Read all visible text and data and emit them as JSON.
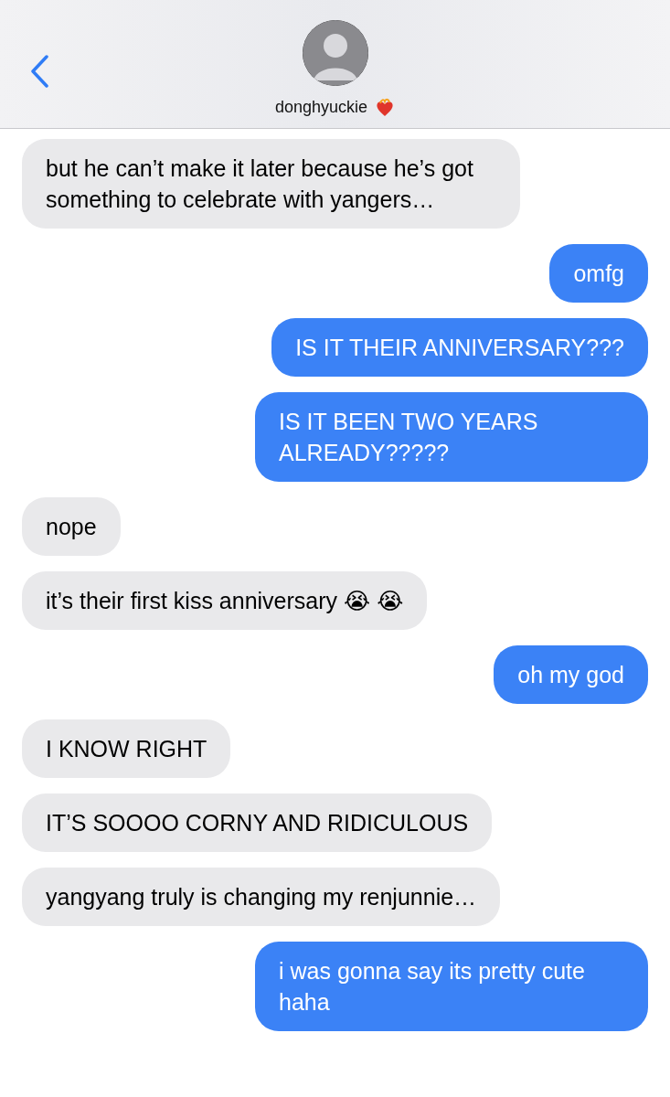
{
  "header": {
    "contact_name": "donghyuckie"
  },
  "messages": [
    {
      "kind": "received",
      "text": "but he can’t make it later because he’s got something to celebrate with yangers…"
    },
    {
      "kind": "sent",
      "text": "omfg"
    },
    {
      "kind": "sent",
      "text": "IS IT THEIR ANNIVERSARY???"
    },
    {
      "kind": "sent",
      "text": "IS IT BEEN TWO YEARS ALREADY?????"
    },
    {
      "kind": "received",
      "text": "nope"
    },
    {
      "kind": "received",
      "text": "it’s their first kiss anniversary 😭 😭"
    },
    {
      "kind": "sent",
      "text": "oh my god"
    },
    {
      "kind": "received",
      "text": "I KNOW RIGHT"
    },
    {
      "kind": "received",
      "text": "IT’S SOOOO CORNY AND RIDICULOUS"
    },
    {
      "kind": "received",
      "text": "yangyang truly is changing my renjunnie…"
    },
    {
      "kind": "sent",
      "text": "i was gonna say its pretty cute haha"
    }
  ]
}
